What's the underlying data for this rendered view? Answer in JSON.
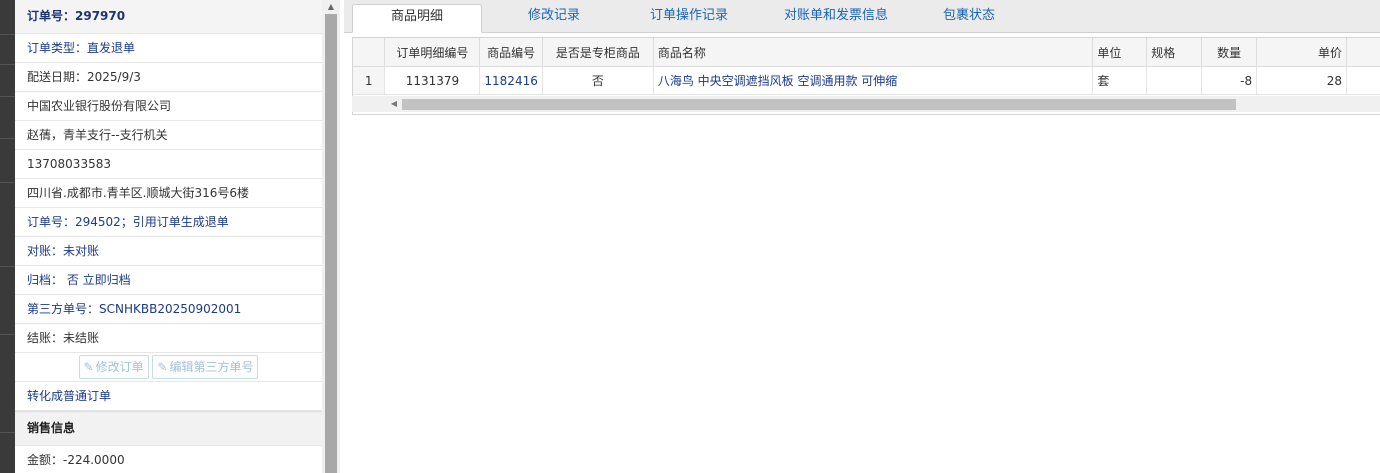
{
  "order_panel": {
    "title": "订单号：297970",
    "order_type": "订单类型：直发退单",
    "delivery_date": "配送日期：2025/9/3",
    "company": "中国农业银行股份有限公司",
    "contact": "赵蒨，青羊支行--支行机关",
    "phone": "13708033583",
    "address": "四川省.成都市.青羊区.顺城大街316号6楼",
    "ref_order": "订单号：294502；引用订单生成退单",
    "reconcile": "对账：未对账",
    "archive": "归档：  否 立即归档",
    "third_party": "第三方单号：SCNHKBB20250902001",
    "settle": "结账：未结账",
    "edit_order_button": "修改订单",
    "edit_third_party_button": "编辑第三方单号",
    "convert_link": "转化成普通订单",
    "sales_section_title": "销售信息",
    "amount": "金额：-224.0000"
  },
  "tabs": [
    {
      "label": "商品明细",
      "active": true
    },
    {
      "label": "修改记录",
      "active": false
    },
    {
      "label": "订单操作记录",
      "active": false
    },
    {
      "label": "对账单和发票信息",
      "active": false
    },
    {
      "label": "包裹状态",
      "active": false
    }
  ],
  "grid": {
    "columns": [
      "订单明细编号",
      "商品编号",
      "是否是专柜商品",
      "商品名称",
      "单位",
      "规格",
      "数量",
      "单价"
    ],
    "rows": [
      {
        "row_number": "1",
        "detail_id": "1131379",
        "product_id": "1182416",
        "is_counter": "否",
        "product_name": "八海鸟 中央空调遮挡风板 空调通用款 可伸缩",
        "unit": "套",
        "spec": "",
        "quantity": "-8",
        "unit_price": "28"
      }
    ]
  },
  "icons": {
    "edit_icon": "pencil-square-icon",
    "scroll_left": "triangle-left-icon",
    "scroll_up": "triangle-up-icon"
  },
  "colors": {
    "link_blue": "#1b3a8c",
    "tab_blue": "#1a64b8",
    "disabled_button": "#a9c2d6"
  }
}
